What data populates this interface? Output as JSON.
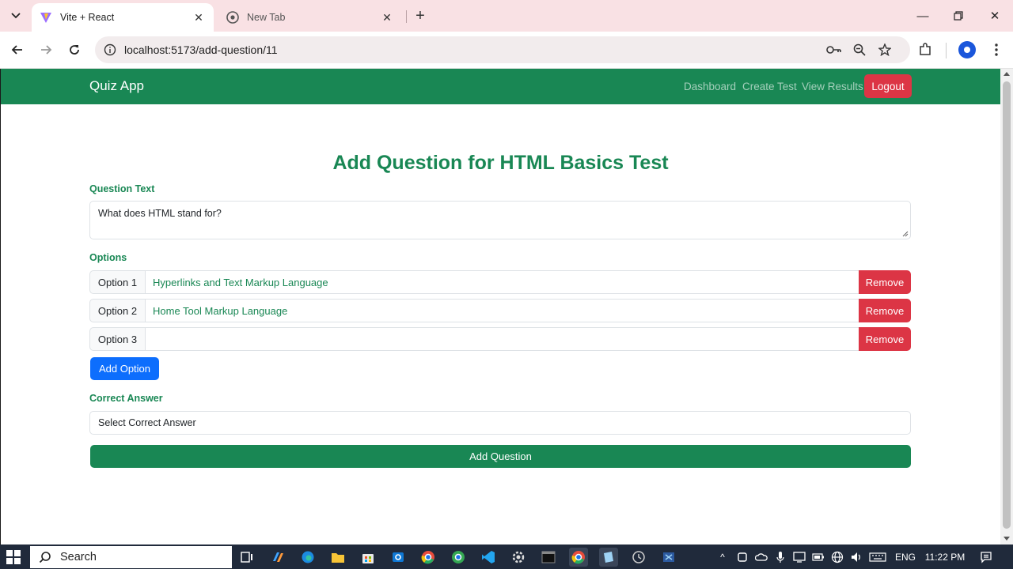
{
  "browser": {
    "tabs": [
      {
        "title": "Vite + React",
        "active": true
      },
      {
        "title": "New Tab",
        "active": false
      }
    ],
    "url": "localhost:5173/add-question/11"
  },
  "navbar": {
    "brand": "Quiz App",
    "links": [
      "Dashboard",
      "Create Test",
      "View Results"
    ],
    "logout": "Logout"
  },
  "page": {
    "heading": "Add Question for HTML Basics Test",
    "question_label": "Question Text",
    "question_value": "What does HTML stand for?",
    "options_label": "Options",
    "options": [
      {
        "label": "Option 1",
        "value": "Hyperlinks and Text Markup Language",
        "remove": "Remove"
      },
      {
        "label": "Option 2",
        "value": "Home Tool Markup Language",
        "remove": "Remove"
      },
      {
        "label": "Option 3",
        "value": "",
        "remove": "Remove"
      }
    ],
    "add_option": "Add Option",
    "correct_label": "Correct Answer",
    "correct_select": "Select Correct Answer",
    "submit": "Add Question"
  },
  "taskbar": {
    "search": "Search",
    "language": "ENG",
    "time": "11:22 PM"
  },
  "colors": {
    "primary_green": "#198754",
    "danger_red": "#dc3545",
    "primary_blue": "#0d6efd",
    "tabstrip_pink": "#f9e1e4"
  }
}
